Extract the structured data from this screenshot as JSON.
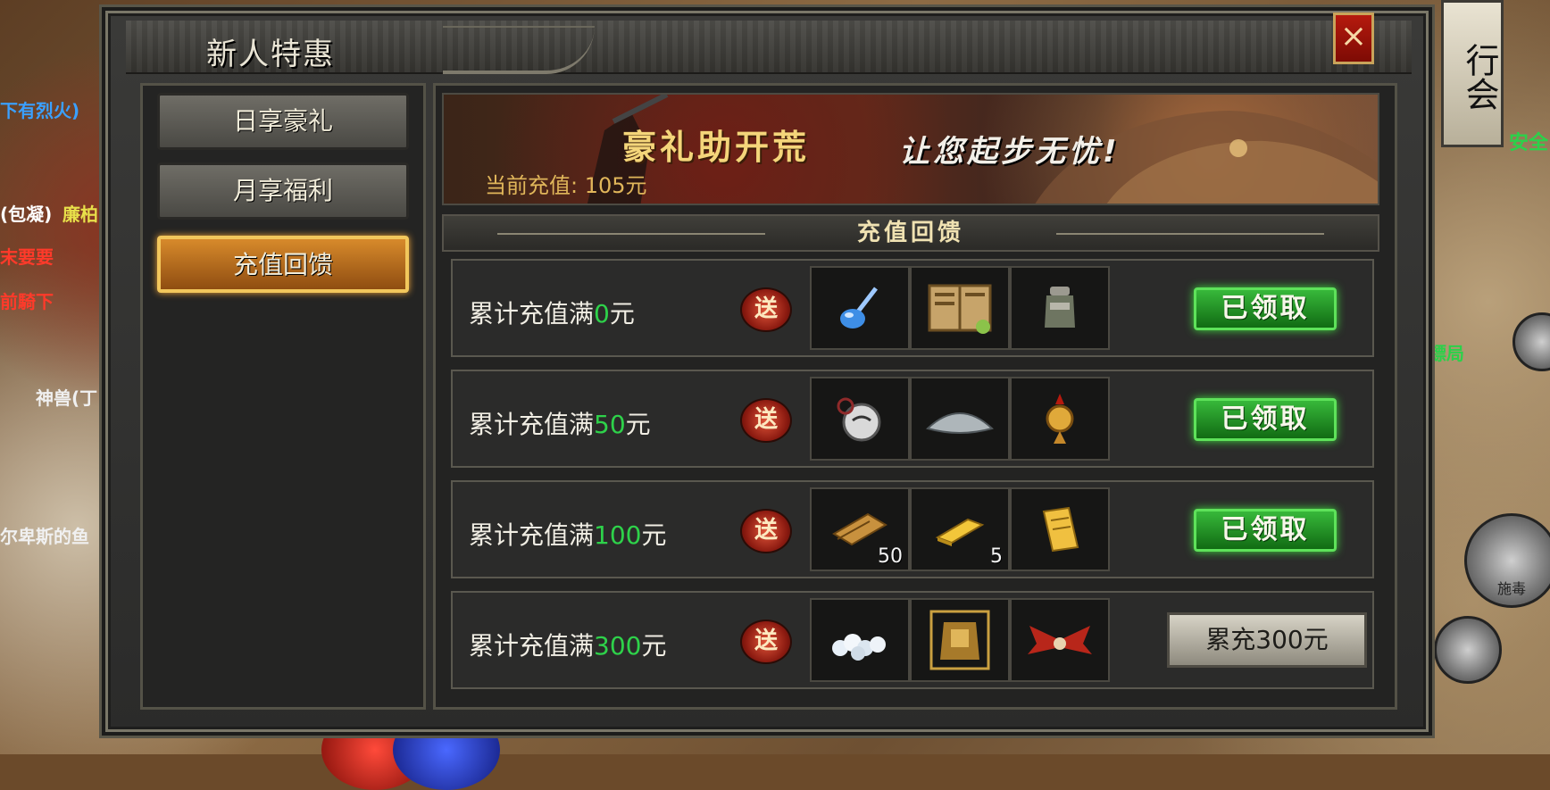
{
  "panel": {
    "title": "新人特惠",
    "close_symbol": "×"
  },
  "side_tag": "行会",
  "world": {
    "labels": [
      {
        "text": "下有烈火)",
        "color": "#3aa0ff"
      },
      {
        "text": "(包凝)",
        "color": "#ffffff"
      },
      {
        "text": "廉柏",
        "color": "#e8e04a"
      },
      {
        "text": "末要要",
        "color": "#ff3a2a"
      },
      {
        "text": "前騎下",
        "color": "#ff3a2a"
      },
      {
        "text": "神兽(丁",
        "color": "#f0f0f0"
      },
      {
        "text": "尔卑斯的鱼",
        "color": "#f0f0f0"
      },
      {
        "text": "安全",
        "color": "#2bd14a"
      },
      {
        "text": "镖局",
        "color": "#2bd14a"
      },
      {
        "text": "施毒",
        "color": "#222222"
      }
    ]
  },
  "menu": {
    "items": [
      {
        "label": "日享豪礼",
        "active": false
      },
      {
        "label": "月享福利",
        "active": false
      },
      {
        "label": "充值回馈",
        "active": true
      }
    ]
  },
  "banner": {
    "title": "豪礼助开荒",
    "subtitle": "让您起步无忧!",
    "current_recharge_label": "当前充值:",
    "current_recharge_value": "105元"
  },
  "section": {
    "title": "充值回馈"
  },
  "gift_symbol": "送",
  "rows": [
    {
      "prefix": "累计充值满",
      "amount": "0",
      "suffix": "元",
      "items": [
        {
          "icon": "blue-potion-icon",
          "qty": ""
        },
        {
          "icon": "skill-book-icon",
          "qty": ""
        },
        {
          "icon": "jar-icon",
          "qty": ""
        }
      ],
      "button": "已领取",
      "button_type": "claimed"
    },
    {
      "prefix": "累计充值满",
      "amount": "50",
      "suffix": "元",
      "items": [
        {
          "icon": "silver-medal-icon",
          "qty": ""
        },
        {
          "icon": "straw-hat-icon",
          "qty": ""
        },
        {
          "icon": "gold-amulet-icon",
          "qty": ""
        }
      ],
      "button": "已领取",
      "button_type": "claimed"
    },
    {
      "prefix": "累计充值满",
      "amount": "100",
      "suffix": "元",
      "items": [
        {
          "icon": "scroll-bundle-icon",
          "qty": "50"
        },
        {
          "icon": "gold-bar-icon",
          "qty": "5"
        },
        {
          "icon": "gold-scroll-icon",
          "qty": ""
        }
      ],
      "button": "已领取",
      "button_type": "claimed"
    },
    {
      "prefix": "累计充值满",
      "amount": "300",
      "suffix": "元",
      "items": [
        {
          "icon": "silver-coins-icon",
          "qty": ""
        },
        {
          "icon": "armor-icon",
          "qty": ""
        },
        {
          "icon": "red-wings-icon",
          "qty": ""
        }
      ],
      "button": "累充300元",
      "button_type": "locked"
    }
  ],
  "colors": {
    "accent_green": "#2ed24a",
    "gold": "#e0b65a",
    "active_tab": "#d78a2b"
  }
}
